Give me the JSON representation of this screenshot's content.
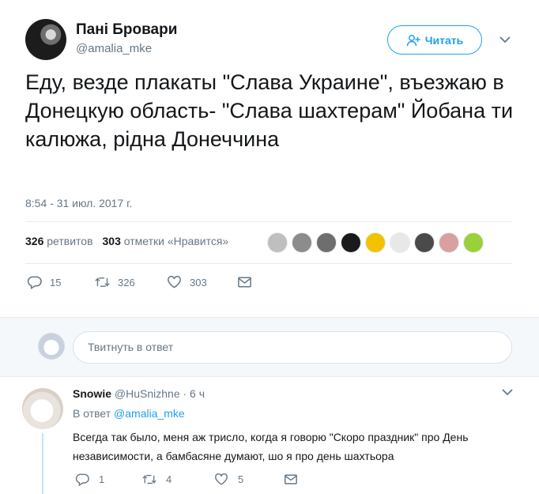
{
  "author": {
    "name": "Пані Бровари",
    "handle": "@amalia_mke"
  },
  "follow_label": "Читать",
  "tweet": {
    "text": "Еду, везде плакаты \"Слава Украине\", въезжаю в Донецкую область- \"Слава шахтерам\" Йобана ти калюжа, рідна Донеччина",
    "timestamp": "8:54 - 31 июл. 2017 г."
  },
  "stats": {
    "retweets_count": "326",
    "retweets_label": "ретвитов",
    "likes_count": "303",
    "likes_label": "отметки «Нравится»"
  },
  "likers": [
    "#bfbfbf",
    "#8c8c8c",
    "#6e6e6e",
    "#1a1a1a",
    "#f2c200",
    "#e8e8e8",
    "#4a4a4a",
    "#d9a0a0",
    "#9ad13a"
  ],
  "actions": {
    "replies": "15",
    "retweets": "326",
    "likes": "303"
  },
  "reply_box": {
    "placeholder": "Твитнуть в ответ"
  },
  "reply": {
    "name": "Snowie",
    "handle": "@HuSnizhne",
    "time": "· 6 ч",
    "in_reply_prefix": "В ответ",
    "in_reply_handle": "@amalia_mke",
    "text": "Всегда так было, меня аж трисло, когда я говорю \"Скоро праздник\" про День независимости, а бамбасяне думают, шо я про день шахтьора",
    "replies": "1",
    "retweets": "4",
    "likes": "5"
  },
  "colors": {
    "accent": "#1da1f2",
    "muted": "#657786",
    "thread_line": "#bbe4fb"
  }
}
